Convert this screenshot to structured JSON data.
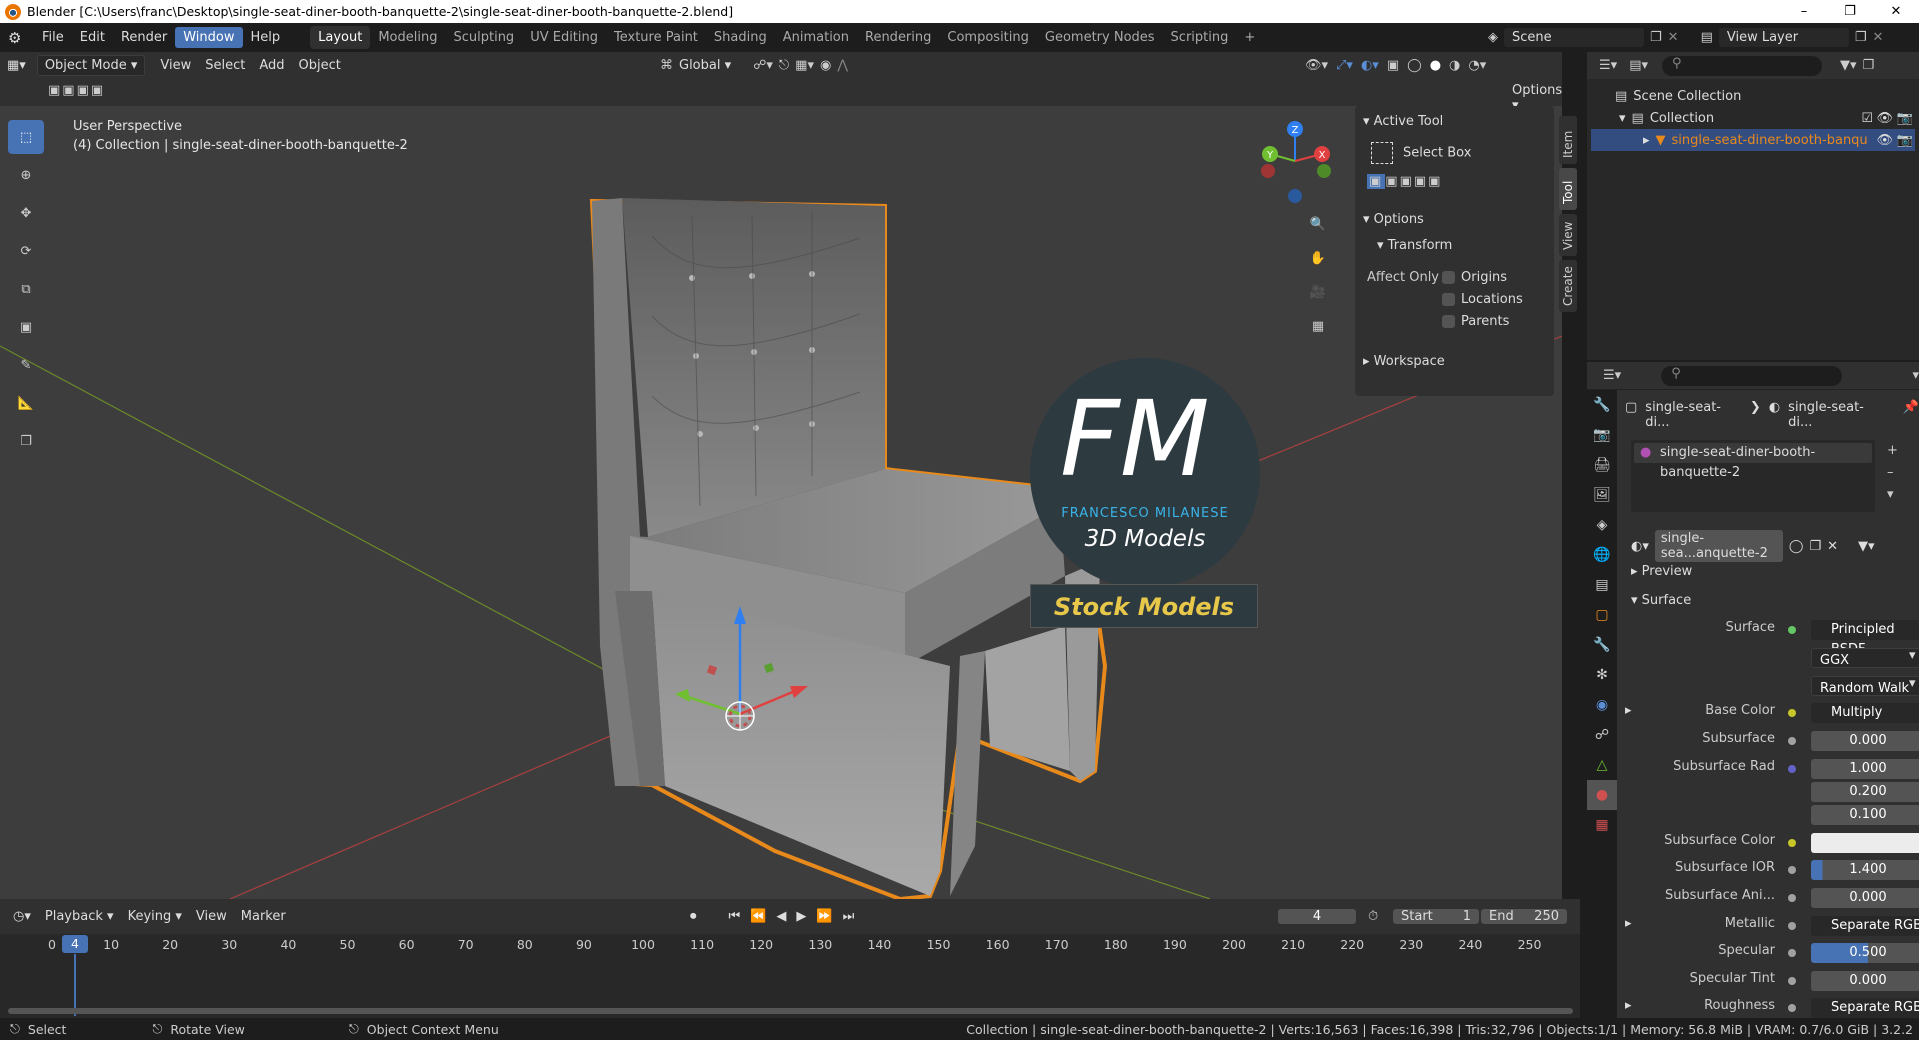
{
  "window": {
    "title": "Blender [C:\\Users\\franc\\Desktop\\single-seat-diner-booth-banquette-2\\single-seat-diner-booth-banquette-2.blend]"
  },
  "menus": [
    "File",
    "Edit",
    "Render",
    "Window",
    "Help"
  ],
  "workspaces": [
    "Layout",
    "Modeling",
    "Sculpting",
    "UV Editing",
    "Texture Paint",
    "Shading",
    "Animation",
    "Rendering",
    "Compositing",
    "Geometry Nodes",
    "Scripting"
  ],
  "scene": {
    "name": "Scene",
    "view_layer": "View Layer"
  },
  "header3d": {
    "mode": "Object Mode",
    "items": [
      "View",
      "Select",
      "Add",
      "Object"
    ],
    "orientation": "Global",
    "options": "Options"
  },
  "viewport": {
    "perspective": "User Perspective",
    "collection_info": "(4) Collection | single-seat-diner-booth-banquette-2",
    "logo_letters": "FM",
    "logo_name": "FRANCESCO MILANESE",
    "logo_sub": "3D Models",
    "logo_banner": "Stock Models"
  },
  "npanel": {
    "active_tool": "Active Tool",
    "select_box": "Select Box",
    "options": "Options",
    "transform": "Transform",
    "affect_only": "Affect Only",
    "origins": "Origins",
    "locations": "Locations",
    "parents": "Parents",
    "workspace": "Workspace",
    "tabs": [
      "Item",
      "Tool",
      "View",
      "Create"
    ]
  },
  "outliner": {
    "scene_collection": "Scene Collection",
    "collection": "Collection",
    "object": "single-seat-diner-booth-banqu"
  },
  "properties": {
    "breadcrumb_1": "single-seat-di...",
    "breadcrumb_2": "single-seat-di...",
    "material_slot": "single-seat-diner-booth-banquette-2",
    "material_name": "single-sea...anquette-2",
    "preview": "Preview",
    "surface_section": "Surface",
    "rows": [
      {
        "label": "Surface",
        "value": "Principled BSDF",
        "kind": "link"
      },
      {
        "label": "",
        "value": "GGX",
        "kind": "dd"
      },
      {
        "label": "",
        "value": "Random Walk",
        "kind": "dd"
      },
      {
        "label": "Base Color",
        "value": "Multiply",
        "kind": "link"
      },
      {
        "label": "Subsurface",
        "value": "0.000",
        "kind": "num"
      },
      {
        "label": "Subsurface Rad",
        "value": "1.000",
        "kind": "num"
      },
      {
        "label": "",
        "value": "0.200",
        "kind": "num"
      },
      {
        "label": "",
        "value": "0.100",
        "kind": "num"
      },
      {
        "label": "Subsurface Color",
        "value": "",
        "kind": "color"
      },
      {
        "label": "Subsurface IOR",
        "value": "1.400",
        "kind": "blue"
      },
      {
        "label": "Subsurface Ani...",
        "value": "0.000",
        "kind": "num"
      },
      {
        "label": "Metallic",
        "value": "Separate RGB",
        "kind": "link"
      },
      {
        "label": "Specular",
        "value": "0.500",
        "kind": "blue"
      },
      {
        "label": "Specular Tint",
        "value": "0.000",
        "kind": "num"
      },
      {
        "label": "Roughness",
        "value": "Separate RGB",
        "kind": "link"
      }
    ]
  },
  "timeline": {
    "menus": [
      "Playback",
      "Keying",
      "View",
      "Marker"
    ],
    "current_frame": "4",
    "start_label": "Start",
    "start": "1",
    "end_label": "End",
    "end": "250",
    "ticks": [
      "0",
      "10",
      "20",
      "30",
      "40",
      "50",
      "60",
      "70",
      "80",
      "90",
      "100",
      "110",
      "120",
      "130",
      "140",
      "150",
      "160",
      "170",
      "180",
      "190",
      "200",
      "210",
      "220",
      "230",
      "240",
      "250"
    ]
  },
  "status": {
    "select": "Select",
    "rotate": "Rotate View",
    "context": "Object Context Menu",
    "stats": "Collection | single-seat-diner-booth-banquette-2 | Verts:16,563 | Faces:16,398 | Tris:32,796 | Objects:1/1 | Memory: 56.8 MiB | VRAM: 0.7/6.0 GiB | 3.2.2"
  }
}
